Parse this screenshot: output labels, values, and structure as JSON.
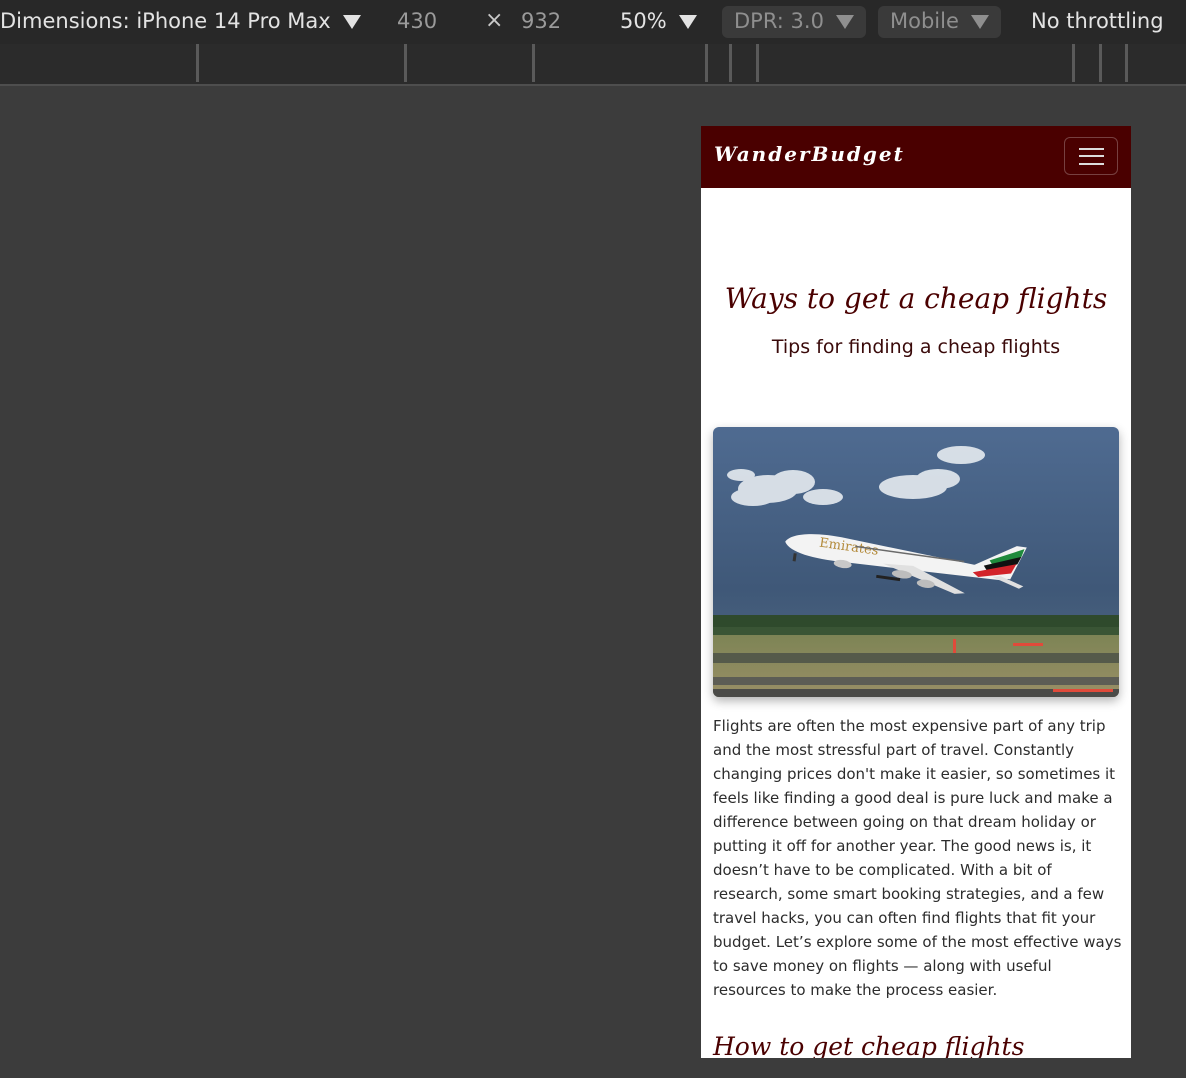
{
  "devtools": {
    "dimensions_label": "Dimensions: iPhone 14 Pro Max",
    "width_value": "430",
    "times_symbol": "×",
    "height_value": "932",
    "zoom_label": "50%",
    "dpr_label": "DPR: 3.0",
    "mode_label": "Mobile",
    "throttling_label": "No throttling"
  },
  "site": {
    "brand": "WanderBudget",
    "hero_title": "Ways to get a cheap flights",
    "hero_subtitle": "Tips for finding a cheap flights",
    "hero_image": {
      "icon": "airplane-photo",
      "livery_text": "Emirates"
    },
    "intro_paragraph": "Flights are often the most expensive part of any trip and the most stressful part of travel. Constantly changing prices don't make it easier, so sometimes it feels like finding a good deal is pure luck and make a difference between going on that dream holiday or putting it off for another year. The good news is, it doesn’t have to be complicated. With a bit of research, some smart booking strategies, and a few travel hacks, you can often find flights that fit your budget. Let’s explore some of the most effective ways to save money on flights — along with useful resources to make the process easier.",
    "section_heading": "How to get cheap flights"
  },
  "colors": {
    "brand_maroon": "#4a0000",
    "devtools_bg": "#282828",
    "canvas_bg": "#3c3c3c"
  }
}
